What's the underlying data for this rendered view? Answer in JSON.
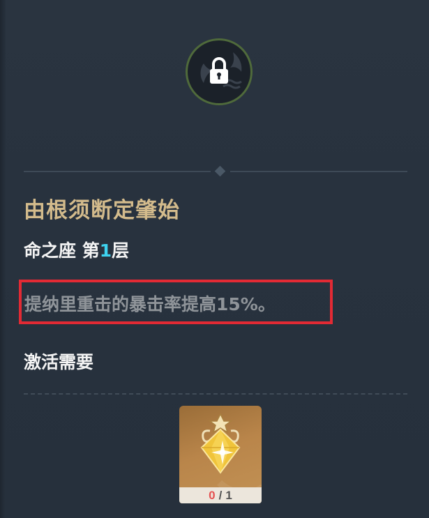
{
  "constellation": {
    "title": "由根须断定肇始",
    "layer_prefix": "命之座 第",
    "layer_number": "1",
    "layer_suffix": "层",
    "description": "提纳里重击的暴击率提高15%。",
    "locked": true
  },
  "requirements": {
    "heading": "激活需要",
    "item": {
      "icon": "gem-stardust-icon",
      "have": "0",
      "separator": "/",
      "need": "1"
    }
  },
  "colors": {
    "background": "#27313d",
    "title": "#d3bb8c",
    "highlight_number": "#3ed3f0",
    "description": "#8f9499",
    "annotation_box": "#e22a34",
    "lock_ring": "#4f6a3b",
    "item_card": "#b9854a",
    "have_count": "#e55252"
  }
}
